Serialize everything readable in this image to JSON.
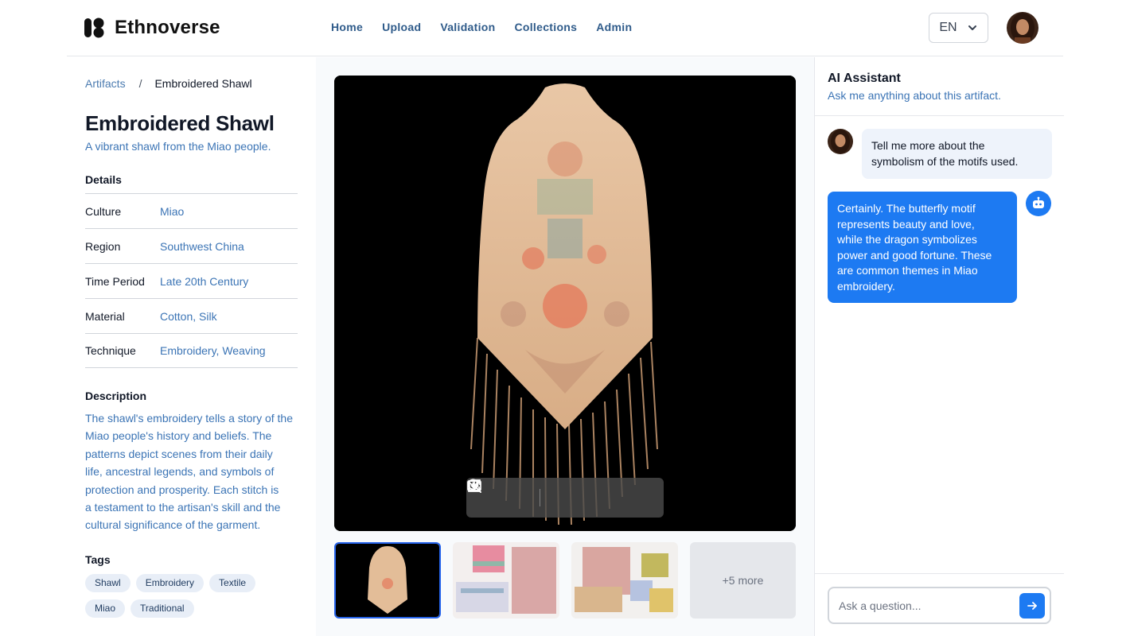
{
  "app": {
    "name": "Ethnoverse"
  },
  "nav": {
    "items": [
      "Home",
      "Upload",
      "Validation",
      "Collections",
      "Admin"
    ]
  },
  "header": {
    "language": "EN"
  },
  "breadcrumb": {
    "parent": "Artifacts",
    "separator": "/",
    "current": "Embroidered Shawl"
  },
  "artifact": {
    "title": "Embroidered Shawl",
    "subtitle": "A vibrant shawl from the Miao people.",
    "details_heading": "Details",
    "details": [
      {
        "label": "Culture",
        "value": "Miao"
      },
      {
        "label": "Region",
        "value": "Southwest China"
      },
      {
        "label": "Time Period",
        "value": "Late 20th Century"
      },
      {
        "label": "Material",
        "value": "Cotton, Silk"
      },
      {
        "label": "Technique",
        "value": "Embroidery, Weaving"
      }
    ],
    "description_heading": "Description",
    "description_lines": [
      "The shawl's embroidery tells a story of the",
      "Miao people's history and beliefs. The",
      "patterns depict scenes from their daily",
      "life, ancestral legends, and symbols of",
      "protection and prosperity. Each stitch is",
      "a testament to the artisan's skill and the",
      "cultural significance of the garment."
    ],
    "tags_heading": "Tags",
    "tags": [
      "Shawl",
      "Embroidery",
      "Textile",
      "Miao",
      "Traditional"
    ]
  },
  "viewer": {
    "toolbar": [
      "zoom-in-icon",
      "zoom-out-icon",
      "mail-icon",
      "download-icon",
      "external-link-icon"
    ],
    "more_label": "+5 more"
  },
  "chat": {
    "title": "AI Assistant",
    "subtitle": "Ask me anything about this artifact.",
    "messages": [
      {
        "role": "user",
        "lines": [
          "Tell me more about the",
          "symbolism of the motifs used."
        ]
      },
      {
        "role": "assistant",
        "lines": [
          "Certainly. The butterfly motif",
          "represents beauty and love,",
          "while the dragon symbolizes",
          "power and good fortune. These",
          "are common themes in Miao",
          "embroidery."
        ]
      }
    ],
    "input_placeholder": "Ask a question...",
    "send_icon": "arrow-right-icon"
  },
  "colors": {
    "accent": "#1d7af2",
    "link": "#3b74b5",
    "nav": "#2f5b8a",
    "tag_bg": "#e8eef7"
  }
}
